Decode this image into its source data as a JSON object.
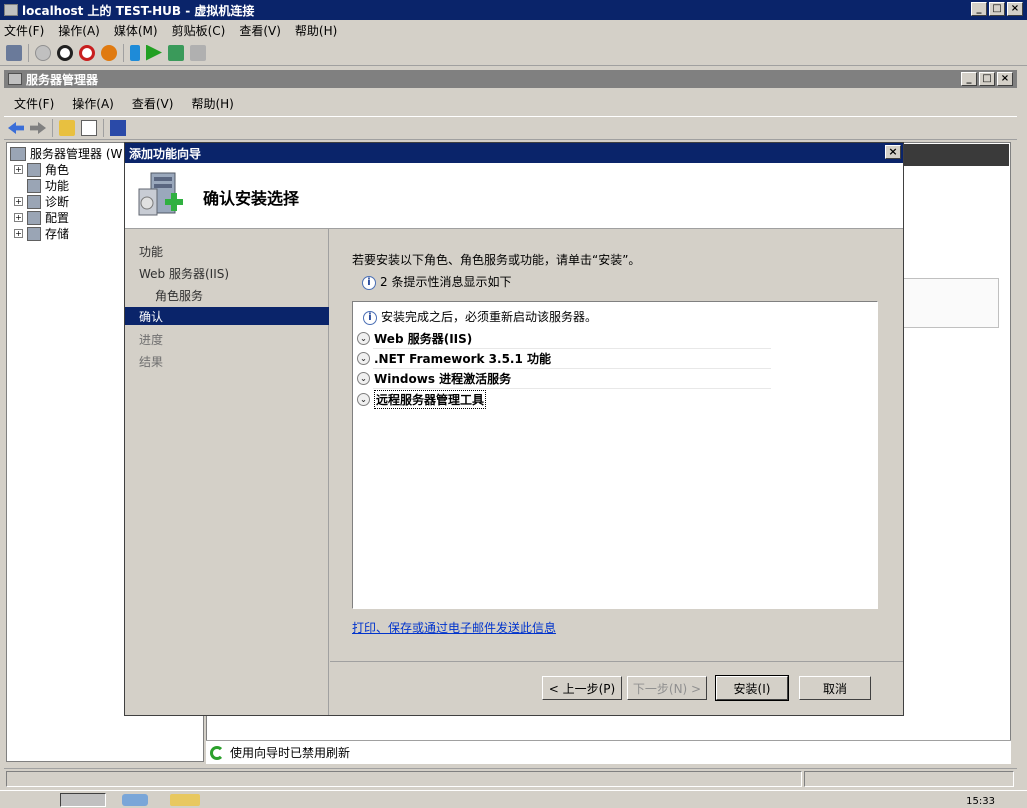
{
  "vm": {
    "title": "localhost 上的 TEST-HUB - 虚拟机连接",
    "menu": [
      "文件(F)",
      "操作(A)",
      "媒体(M)",
      "剪贴板(C)",
      "查看(V)",
      "帮助(H)"
    ]
  },
  "server_manager": {
    "title": "服务器管理器",
    "menu": [
      "文件(F)",
      "操作(A)",
      "查看(V)",
      "帮助(H)"
    ],
    "tree": {
      "root": "服务器管理器 (W",
      "items": [
        "角色",
        "功能",
        "诊断",
        "配置",
        "存储"
      ]
    },
    "status_text": "使用向导时已禁用刷新"
  },
  "dialog": {
    "title": "添加功能向导",
    "header_title": "确认安装选择",
    "nav": {
      "items": [
        "功能",
        "Web 服务器(IIS)",
        "角色服务",
        "确认",
        "进度",
        "结果"
      ],
      "active": "确认"
    },
    "intro": "若要安装以下角色、角色服务或功能，请单击“安装”。",
    "warning_count": "2 条提示性消息显示如下",
    "restart_notice": "安装完成之后，必须重新启动该服务器。",
    "results": [
      "Web 服务器(IIS)",
      ".NET Framework 3.5.1 功能",
      "Windows 进程激活服务",
      "远程服务器管理工具"
    ],
    "print_link": "打印、保存或通过电子邮件发送此信息",
    "buttons": {
      "back": "< 上一步(P)",
      "next": "下一步(N) >",
      "install": "安装(I)",
      "cancel": "取消"
    }
  },
  "taskbar": {
    "clock": "15:33"
  },
  "colors": {
    "titlebar_active": "#0a246a",
    "titlebar_inactive": "#808080",
    "window_bg": "#d4d0c8",
    "link": "#0033cc"
  }
}
